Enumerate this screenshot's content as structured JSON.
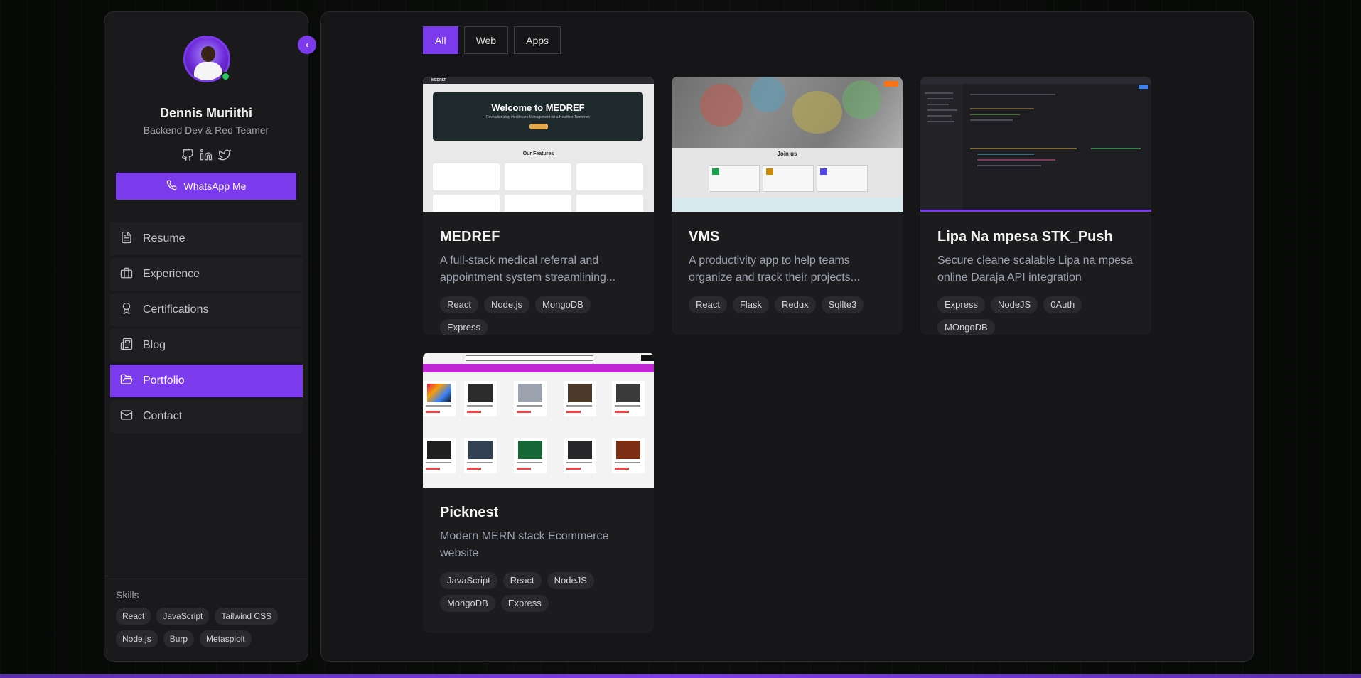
{
  "profile": {
    "name": "Dennis Muriithi",
    "role": "Backend Dev & Red Teamer",
    "socials": [
      "github-icon",
      "linkedin-icon",
      "twitter-icon"
    ]
  },
  "cta": {
    "label": "WhatsApp Me"
  },
  "nav": [
    {
      "label": "Resume",
      "icon": "document-icon",
      "active": false
    },
    {
      "label": "Experience",
      "icon": "briefcase-icon",
      "active": false
    },
    {
      "label": "Certifications",
      "icon": "award-icon",
      "active": false
    },
    {
      "label": "Blog",
      "icon": "newspaper-icon",
      "active": false
    },
    {
      "label": "Portfolio",
      "icon": "folder-open-icon",
      "active": true
    },
    {
      "label": "Contact",
      "icon": "mail-icon",
      "active": false
    }
  ],
  "skills": {
    "title": "Skills",
    "items": [
      "React",
      "JavaScript",
      "Tailwind CSS",
      "Node.js",
      "Burp",
      "Metasploit"
    ]
  },
  "filters": [
    {
      "label": "All",
      "active": true
    },
    {
      "label": "Web",
      "active": false
    },
    {
      "label": "Apps",
      "active": false
    }
  ],
  "projects": [
    {
      "title": "MEDREF",
      "description": "A full-stack medical referral and appointment system streamlining...",
      "tags": [
        "React",
        "Node.js",
        "MongoDB",
        "Express"
      ],
      "thumb": {
        "brand": "MEDREF",
        "hero_title": "Welcome to MEDREF",
        "hero_sub": "Revolutionizing Healthcare Management for a Healthier Tomorrow",
        "section": "Our Features"
      }
    },
    {
      "title": "VMS",
      "description": "A productivity app to help teams organize and track their projects...",
      "tags": [
        "React",
        "Flask",
        "Redux",
        "Sqllte3"
      ],
      "thumb": {
        "heading": "Join us"
      }
    },
    {
      "title": "Lipa Na mpesa STK_Push",
      "description": "Secure cleane scalable Lipa na mpesa online Daraja API integration",
      "tags": [
        "Express",
        "NodeJS",
        "0Auth",
        "MOngoDB"
      ]
    },
    {
      "title": "Picknest",
      "description": "Modern MERN stack Ecommerce website",
      "tags": [
        "JavaScript",
        "React",
        "NodeJS",
        "MongoDB",
        "Express"
      ]
    }
  ],
  "colors": {
    "accent": "#7c3aed",
    "online": "#22c55e",
    "panel": "#1a1a1c"
  }
}
